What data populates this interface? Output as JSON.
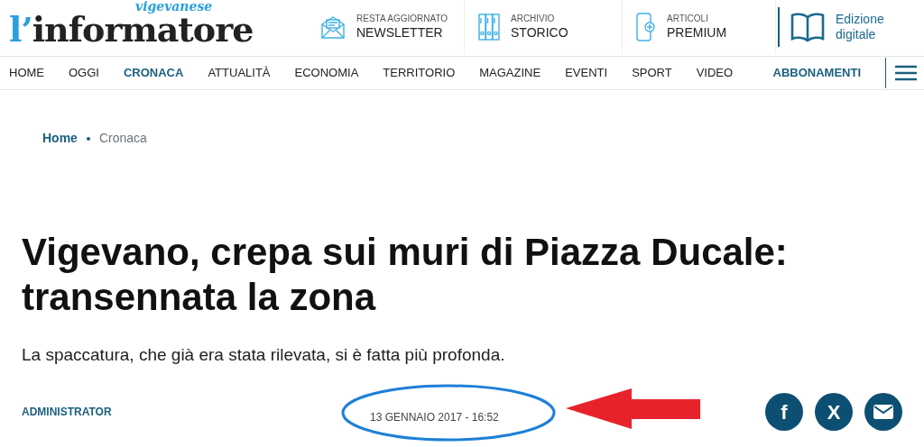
{
  "logo": {
    "tagline": "vigevanese",
    "apostrophe": "l’",
    "name": "informatore"
  },
  "top_links": [
    {
      "kind": "newsletter",
      "small": "RESTA AGGIORNATO",
      "big": "NEWSLETTER"
    },
    {
      "kind": "archive",
      "small": "ARCHIVIO",
      "big": "STORICO"
    },
    {
      "kind": "premium",
      "small": "ARTICOLI",
      "big": "PREMIUM"
    }
  ],
  "edition": {
    "line1": "Edizione",
    "line2": "digitale"
  },
  "nav": [
    {
      "label": "HOME",
      "selected": false
    },
    {
      "label": "OGGI",
      "selected": false
    },
    {
      "label": "CRONACA",
      "selected": true
    },
    {
      "label": "ATTUALITÀ",
      "selected": false
    },
    {
      "label": "ECONOMIA",
      "selected": false
    },
    {
      "label": "TERRITORIO",
      "selected": false
    },
    {
      "label": "MAGAZINE",
      "selected": false
    },
    {
      "label": "EVENTI",
      "selected": false
    },
    {
      "label": "SPORT",
      "selected": false
    },
    {
      "label": "VIDEO",
      "selected": false
    }
  ],
  "subscribe": "ABBONAMENTI",
  "breadcrumb": [
    "Home",
    "Cronaca"
  ],
  "headline": "Vigevano, crepa sui muri di Piazza Ducale: transennata la zona",
  "subtitle": "La spaccatura, che già era stata rilevata, si è fatta più profonda.",
  "author": "ADMINISTRATOR",
  "date": "13 GENNAIO 2017 - 16:52",
  "share": [
    {
      "kind": "facebook",
      "label": "f"
    },
    {
      "kind": "x",
      "label": "X"
    },
    {
      "kind": "email"
    }
  ],
  "annotations": [
    {
      "kind": "ellipse",
      "color": "#1e7fd8"
    },
    {
      "kind": "arrow",
      "color": "#e8222a"
    }
  ]
}
